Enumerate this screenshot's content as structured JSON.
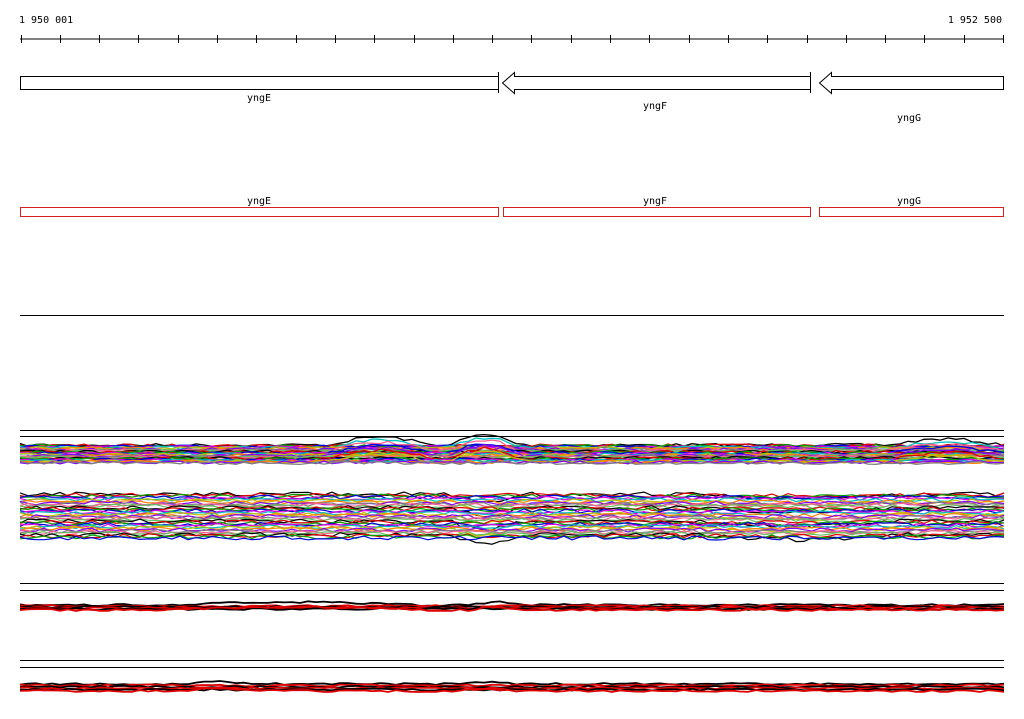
{
  "ruler": {
    "start_label": "1 950 001",
    "end_label": "1 952 500"
  },
  "genes": [
    {
      "name": "yngE",
      "strand": "+"
    },
    {
      "name": "yngF",
      "strand": "-"
    },
    {
      "name": "yngG",
      "strand": "-"
    }
  ],
  "annotation_track": {
    "outline_color": "#d62020",
    "labels": [
      "yngE",
      "yngF",
      "yngG"
    ]
  },
  "colors": {
    "axis": "#000000",
    "track_black": "#000000",
    "track_red": "#e00000",
    "palette": [
      "#000000",
      "#e00000",
      "#00a000",
      "#0000e0",
      "#e000e0",
      "#00c0c0",
      "#c0c000",
      "#ff8000",
      "#8000ff",
      "#808080",
      "#ff6090",
      "#60c060"
    ]
  }
}
